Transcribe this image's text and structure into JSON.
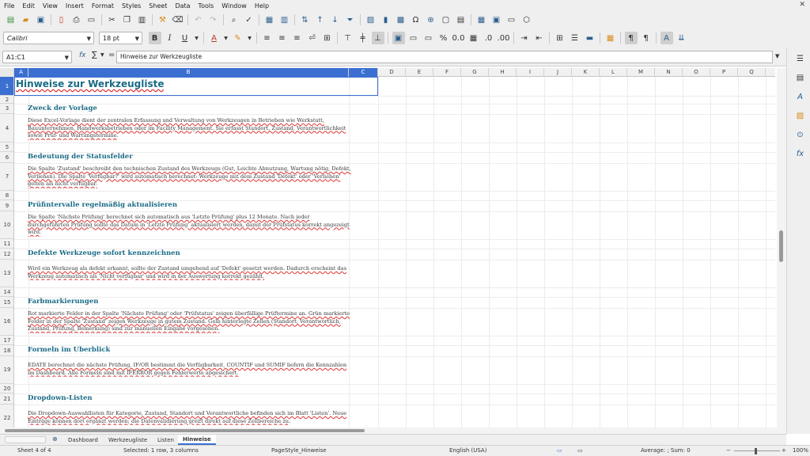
{
  "menu": [
    "File",
    "Edit",
    "View",
    "Insert",
    "Format",
    "Styles",
    "Sheet",
    "Data",
    "Tools",
    "Window",
    "Help"
  ],
  "format_bar": {
    "font_name": "Calibri",
    "font_size": "18 pt"
  },
  "formula_bar": {
    "name_box": "A1:C1",
    "sum_symbol": "∑",
    "equals": "=",
    "fx": "fx",
    "content": "Hinweise zur Werkzeugliste"
  },
  "columns": [
    "A",
    "B",
    "C",
    "D",
    "E",
    "F",
    "G",
    "H",
    "I",
    "J",
    "K",
    "L",
    "M",
    "N",
    "O",
    "P",
    "Q"
  ],
  "rows": [
    "1",
    "2",
    "3",
    "4",
    "5",
    "6",
    "7",
    "8",
    "9",
    "10",
    "11",
    "12",
    "13",
    "14",
    "15",
    "16",
    "17",
    "18",
    "19",
    "20",
    "21",
    "22"
  ],
  "content": {
    "title": "Hinweise zur Werkzeugliste",
    "sections": [
      {
        "heading": "Zweck der Vorlage",
        "text": "Diese Excel-Vorlage dient der zentralen Erfassung und Verwaltung von Werkzeugen in Betrieben wie Werkstatt, Bauunternehmen, Handwerksbetrieben oder im Facility Management. Sie erfasst Standort, Zustand, Verantwortlichkeit sowie Prüf- und Wartungstermine."
      },
      {
        "heading": "Bedeutung der Statusfelder",
        "text": "Die Spalte 'Zustand' beschreibt den technischen Zustand des Werkzeugs (Gut, Leichte Abnutzung, Wartung nötig, Defekt, Verliehen). Die Spalte 'Verfügbar?' wird automatisch berechnet: Werkzeuge mit dem Zustand 'Defekt' oder 'Verliehen' gelten als nicht verfügbar."
      },
      {
        "heading": "Prüfintervalle regelmäßig aktualisieren",
        "text": "Die Spalte 'Nächste Prüfung' berechnet sich automatisch aus 'Letzte Prüfung' plus 12 Monate. Nach jeder durchgeführten Prüfung sollte das Datum in 'Letzte Prüfung' aktualisiert werden, damit der Prüfstatus korrekt angezeigt wird."
      },
      {
        "heading": "Defekte Werkzeuge sofort kennzeichnen",
        "text": "Wird ein Werkzeug als defekt erkannt, sollte der Zustand umgehend auf 'Defekt' gesetzt werden. Dadurch erscheint das Werkzeug automatisch als 'Nicht verfügbar' und wird in der Auswertung korrekt gezählt."
      },
      {
        "heading": "Farbmarkierungen",
        "text": "Rot markierte Felder in der Spalte 'Nächste Prüfung' oder 'Prüfstatus' zeigen überfällige Prüftermine an. Grün markierte Felder in der Spalte 'Zustand' zeigen Werkzeuge in gutem Zustand. Gelb hinterlegte Zellen (Standort, Verantwortlich, Zustand, Prüfung, Bemerkung) sind zur manuellen Eingabe vorgesehen."
      },
      {
        "heading": "Formeln im Überblick",
        "text": "EDATE berechnet die nächste Prüfung, IF/OR bestimmt die Verfügbarkeit, COUNTIF und SUMIF liefern die Kennzahlen im Dashboard. Alle Formeln sind mit IFERROR gegen Fehlerwerte abgesichert."
      },
      {
        "heading": "Dropdown-Listen",
        "text": "Die Dropdown-Auswahllisten für Kategorie, Zustand, Standort und Verantwortliche befinden sich im Blatt 'Listen'. Neue Einträge können dort ergänzt werden; die Datenvalidierung greift direkt auf diese Zellbereiche zu."
      }
    ]
  },
  "sheet_tabs": [
    "Dashboard",
    "Werkzeugliste",
    "Listen",
    "Hinweise"
  ],
  "active_tab": "Hinweise",
  "status": {
    "sheet": "Sheet 4 of 4",
    "selection": "Selected: 1 row, 3 columns",
    "page_style": "PageStyle_Hinweise",
    "language": "English (USA)",
    "sum": "Average: ; Sum: 0",
    "zoom": "100%"
  },
  "colors": {
    "accent": "#3b6fd1",
    "heading": "#1a6b86",
    "spell": "#d33333"
  }
}
